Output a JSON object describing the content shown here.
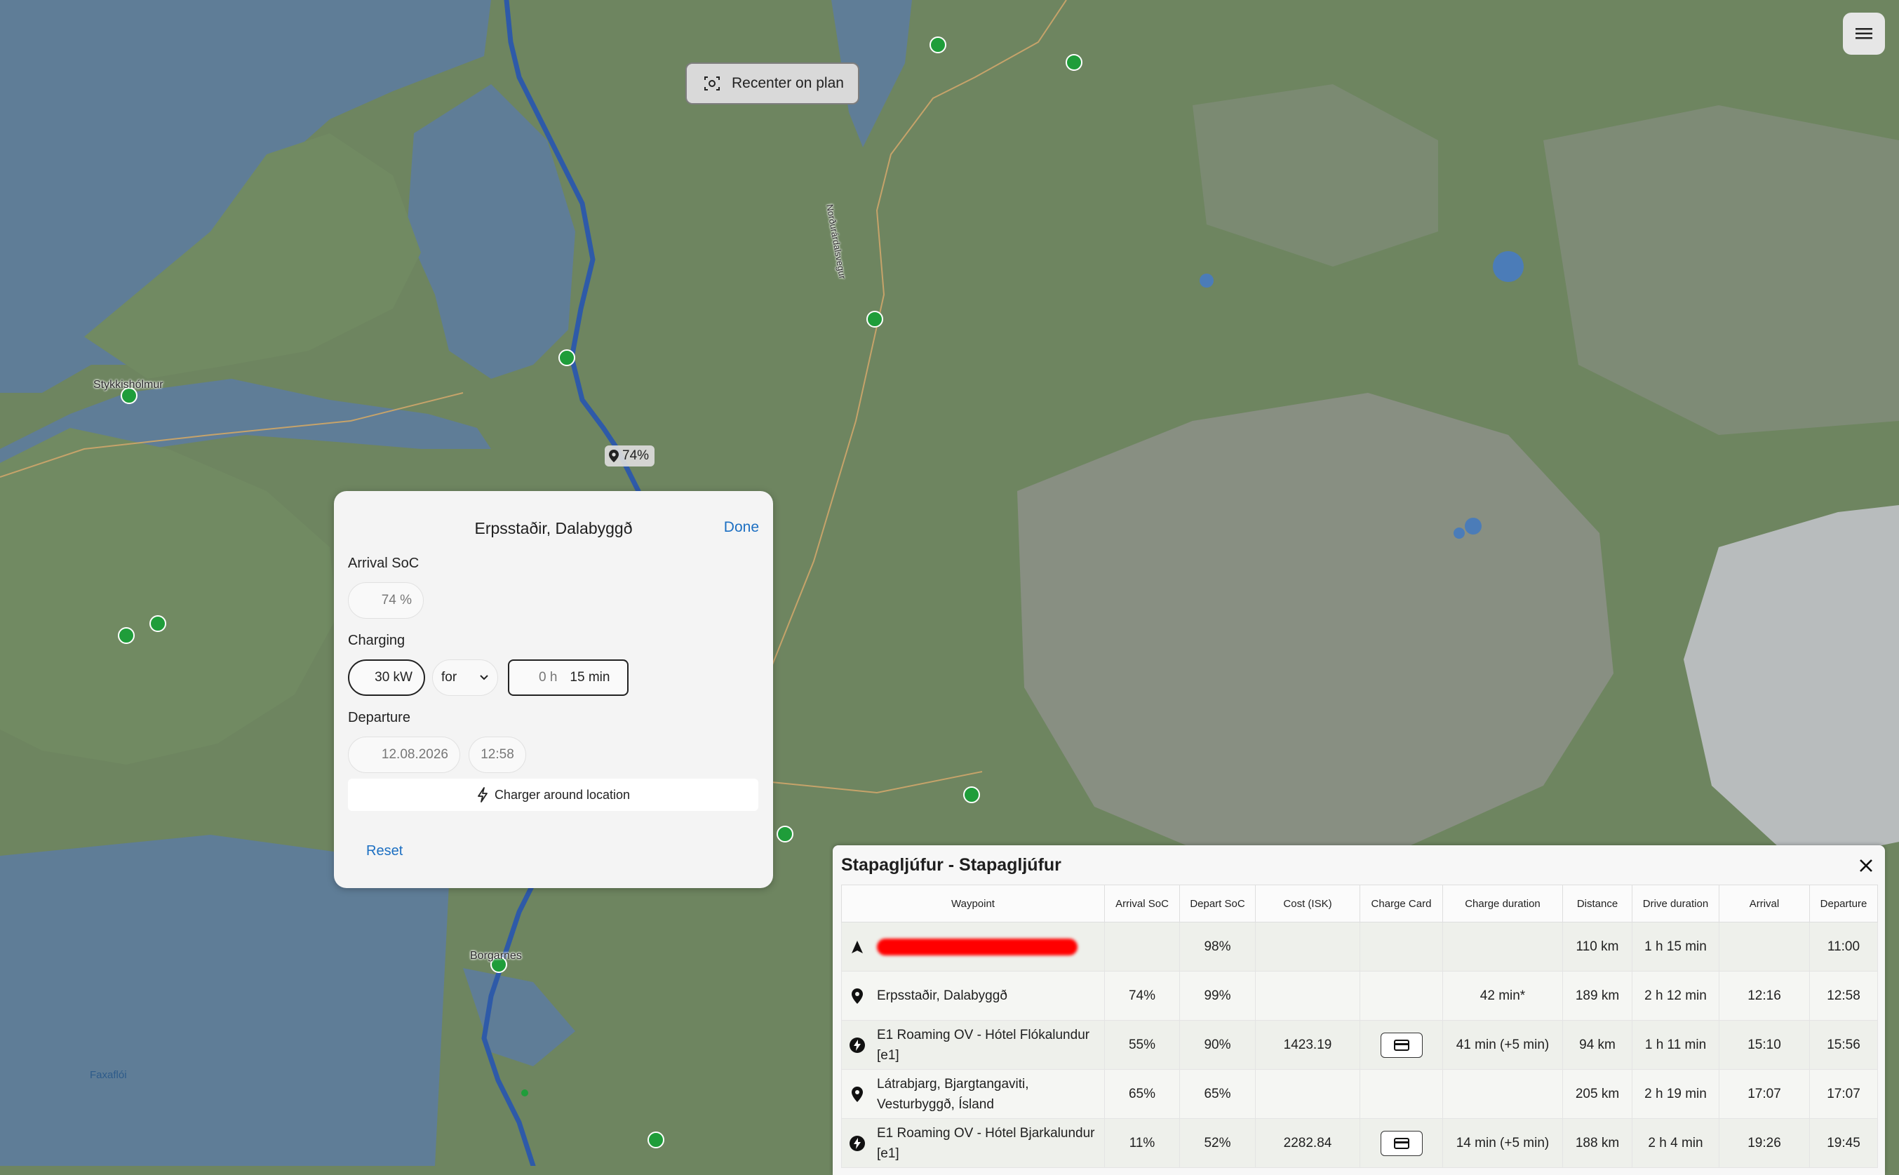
{
  "map": {
    "labels": {
      "stykkisholmur": "Stykkishólmur",
      "borgarnes": "Borgarnes",
      "faxafloi": "Faxaflói",
      "road": "Norðurárdalsvegur"
    },
    "soc_marker": "74%",
    "recenter_label": "Recenter on plan",
    "colors": {
      "route": "#2e5aa8",
      "charger": "#1f9d3a",
      "land": "#6e8560",
      "sea": "#5f7d97"
    }
  },
  "waypoint_panel": {
    "title": "Erpsstaðir, Dalabyggð",
    "done": "Done",
    "arrival_label": "Arrival SoC",
    "arrival_value": "74 %",
    "charging_label": "Charging",
    "power": "30 kW",
    "mode": "for",
    "duration_h": "0 h",
    "duration_min": "15 min",
    "departure_label": "Departure",
    "departure_date": "12.08.2026",
    "departure_time": "12:58",
    "charger_btn": "Charger around location",
    "reset": "Reset"
  },
  "itinerary": {
    "title": "Stapagljúfur - Stapagljúfur",
    "columns": [
      "Waypoint",
      "Arrival SoC",
      "Depart SoC",
      "Cost (ISK)",
      "Charge Card",
      "Charge duration",
      "Distance",
      "Drive duration",
      "Arrival",
      "Departure"
    ],
    "rows": [
      {
        "icon": "navigation-arrow-icon",
        "name": "",
        "arrival_soc": "",
        "depart_soc": "98%",
        "cost": "",
        "card": false,
        "charge_duration": "",
        "distance": "110 km",
        "drive": "1 h 15 min",
        "arrival": "",
        "departure": "11:00"
      },
      {
        "icon": "location-pin-icon",
        "name": "Erpsstaðir, Dalabyggð",
        "arrival_soc": "74%",
        "depart_soc": "99%",
        "cost": "",
        "card": false,
        "charge_duration": "42 min*",
        "distance": "189 km",
        "drive": "2 h 12 min",
        "arrival": "12:16",
        "departure": "12:58"
      },
      {
        "icon": "charger-bolt-icon",
        "name": "E1 Roaming OV - Hótel Flókalundur [e1]",
        "arrival_soc": "55%",
        "depart_soc": "90%",
        "cost": "1423.19",
        "card": true,
        "charge_duration": "41 min (+5 min)",
        "distance": "94 km",
        "drive": "1 h 11 min",
        "arrival": "15:10",
        "departure": "15:56"
      },
      {
        "icon": "location-pin-icon",
        "name": "Látrabjarg, Bjargtangaviti, Vesturbyggð, Ísland",
        "arrival_soc": "65%",
        "depart_soc": "65%",
        "cost": "",
        "card": false,
        "charge_duration": "",
        "distance": "205 km",
        "drive": "2 h 19 min",
        "arrival": "17:07",
        "departure": "17:07"
      },
      {
        "icon": "charger-bolt-icon",
        "name": "E1 Roaming OV - Hótel Bjarkalundur [e1]",
        "arrival_soc": "11%",
        "depart_soc": "52%",
        "cost": "2282.84",
        "card": true,
        "charge_duration": "14 min (+5 min)",
        "distance": "188 km",
        "drive": "2 h 4 min",
        "arrival": "19:26",
        "departure": "19:45"
      }
    ]
  }
}
